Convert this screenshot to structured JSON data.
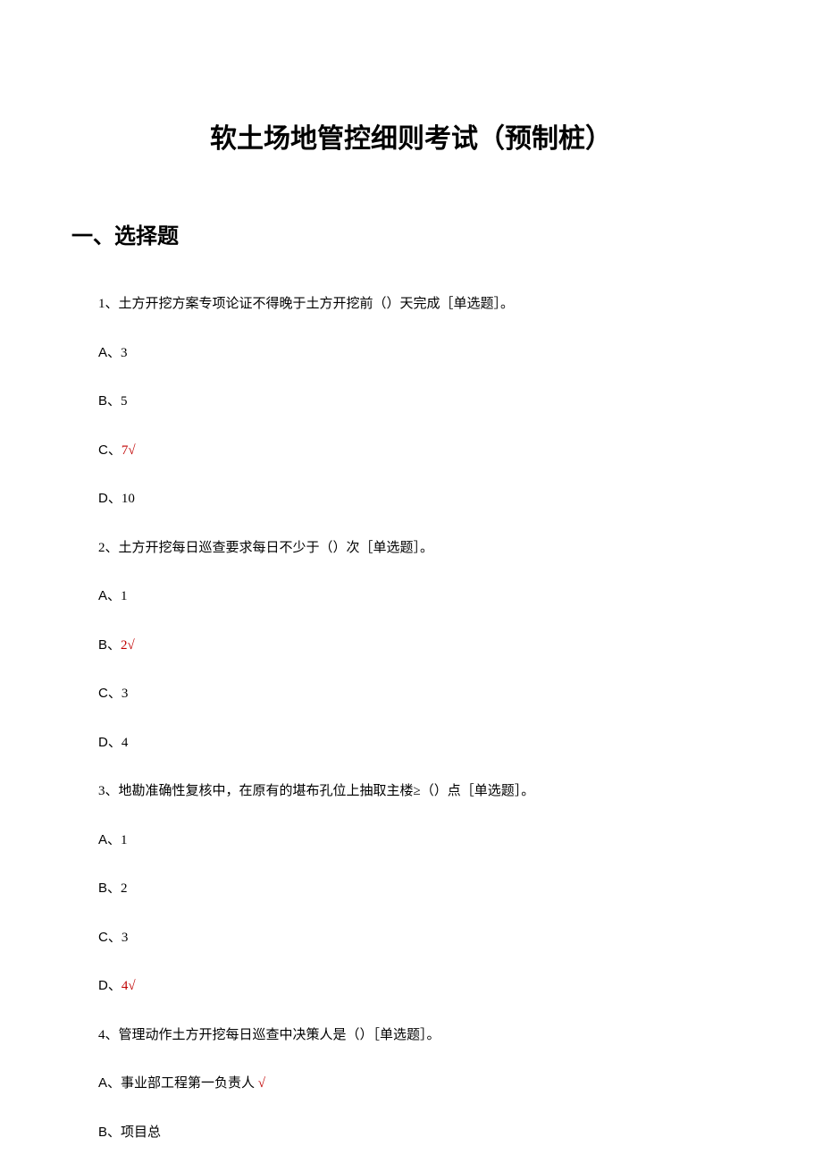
{
  "title": "软土场地管控细则考试（预制桩）",
  "sectionHeading": "一、选择题",
  "questions": [
    {
      "text": "1、土方开挖方案专项论证不得晚于土方开挖前（）天完成［单选题］。",
      "options": [
        {
          "prefix": "A、",
          "value": "3",
          "correct": false
        },
        {
          "prefix": "B、",
          "value": "5",
          "correct": false
        },
        {
          "prefix": "C、",
          "value": "7",
          "correct": true
        },
        {
          "prefix": "D、",
          "value": "10",
          "correct": false
        }
      ]
    },
    {
      "text": "2、土方开挖每日巡查要求每日不少于（）次［单选题］。",
      "options": [
        {
          "prefix": "A、",
          "value": "1",
          "correct": false
        },
        {
          "prefix": "B、",
          "value": "2",
          "correct": true
        },
        {
          "prefix": "C、",
          "value": "3",
          "correct": false
        },
        {
          "prefix": "D、",
          "value": "4",
          "correct": false
        }
      ]
    },
    {
      "text": "3、地勘准确性复核中，在原有的堪布孔位上抽取主楼≥（）点［单选题］。",
      "options": [
        {
          "prefix": "A、",
          "value": "1",
          "correct": false
        },
        {
          "prefix": "B、",
          "value": "2",
          "correct": false
        },
        {
          "prefix": "C、",
          "value": "3",
          "correct": false
        },
        {
          "prefix": "D、",
          "value": "4",
          "correct": true
        }
      ]
    },
    {
      "text": "4、管理动作土方开挖每日巡查中决策人是（）［单选题］。",
      "options": [
        {
          "prefix": "A、",
          "value": "事业部工程第一负责人",
          "correct": true
        },
        {
          "prefix": "B、",
          "value": "项目总",
          "correct": false
        }
      ]
    }
  ],
  "checkMark": "√"
}
